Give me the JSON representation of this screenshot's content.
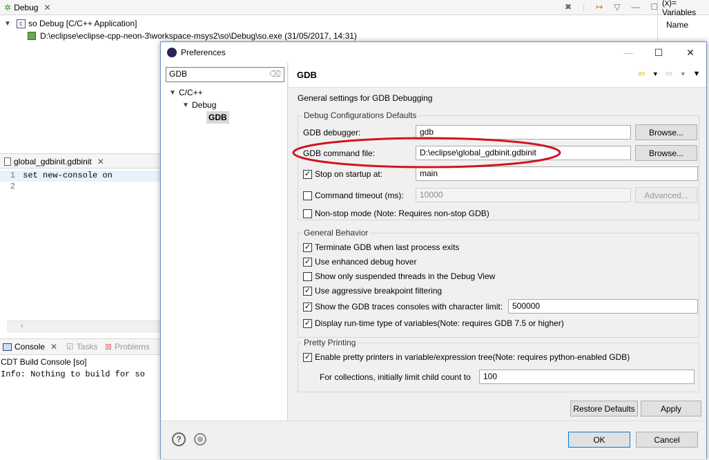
{
  "debug_view": {
    "tab_label": "Debug",
    "launch_label": "so Debug [C/C++ Application]",
    "process_label": "D:\\eclipse\\eclipse-cpp-neon-3\\workspace-msys2\\so\\Debug\\so.exe (31/05/2017, 14:31)"
  },
  "variables_view": {
    "tab_label": "(x)= Variables",
    "column_name": "Name"
  },
  "editor": {
    "tab_label": "global_gdbinit.gdbinit",
    "lines": [
      {
        "number": "1",
        "text": "set new-console on"
      },
      {
        "number": "2",
        "text": ""
      }
    ]
  },
  "console_view": {
    "tabs": [
      "Console",
      "Tasks",
      "Problems"
    ],
    "title": "CDT Build Console [so]",
    "output": "Info: Nothing to build for so"
  },
  "dialog": {
    "title": "Preferences",
    "filter_value": "GDB",
    "tree": [
      {
        "label": "C/C++",
        "depth": 0
      },
      {
        "label": "Debug",
        "depth": 1
      },
      {
        "label": "GDB",
        "depth": 2,
        "selected": true
      }
    ],
    "page_title": "GDB",
    "description": "General settings for GDB Debugging",
    "defaults_group": {
      "title": "Debug Configurations Defaults",
      "gdb_debugger_label": "GDB debugger:",
      "gdb_debugger_value": "gdb",
      "gdb_command_file_label": "GDB command file:",
      "gdb_command_file_value": "D:\\eclipse\\global_gdbinit.gdbinit",
      "browse_label": "Browse...",
      "stop_on_startup_label": "Stop on startup at:",
      "stop_on_startup_value": "main",
      "stop_on_startup_checked": true,
      "command_timeout_label": "Command timeout (ms):",
      "command_timeout_value": "10000",
      "command_timeout_checked": false,
      "advanced_label": "Advanced...",
      "non_stop_label": "Non-stop mode (Note: Requires non-stop GDB)",
      "non_stop_checked": false
    },
    "behavior_group": {
      "title": "General Behavior",
      "items": [
        {
          "label": "Terminate GDB when last process exits",
          "checked": true
        },
        {
          "label": "Use enhanced debug hover",
          "checked": true
        },
        {
          "label": "Show only suspended threads in the Debug View",
          "checked": false
        },
        {
          "label": "Use aggressive breakpoint filtering",
          "checked": true
        },
        {
          "label": "Show the GDB traces consoles with character limit:",
          "checked": true
        },
        {
          "label": "Display run-time type of variables(Note: requires GDB 7.5 or higher)",
          "checked": true
        }
      ],
      "trace_limit_value": "500000"
    },
    "pretty_group": {
      "title": "Pretty Printing",
      "enable_label": "Enable pretty printers in variable/expression tree(Note: requires python-enabled GDB)",
      "enable_checked": true,
      "limit_label": "For collections, initially limit child count to",
      "limit_value": "100"
    },
    "buttons": {
      "restore_defaults": "Restore Defaults",
      "apply": "Apply",
      "ok": "OK",
      "cancel": "Cancel"
    },
    "highlight_color": "#d0141e"
  }
}
